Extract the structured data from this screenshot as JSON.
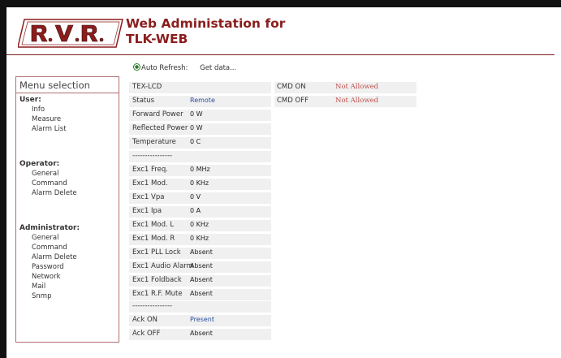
{
  "header": {
    "logo_text": "R.V.R.",
    "title_line1": "Web Administation for",
    "title_line2": "TLK-WEB"
  },
  "refresh": {
    "auto_refresh_label": "Auto Refresh:",
    "get_data_label": "Get data..."
  },
  "menu": {
    "title": "Menu selection",
    "user": {
      "label": "User:",
      "items": [
        "Info",
        "Measure",
        "Alarm List"
      ]
    },
    "operator": {
      "label": "Operator:",
      "items": [
        "General",
        "Command",
        "Alarm Delete"
      ]
    },
    "administrator": {
      "label": "Administrator:",
      "items": [
        "General",
        "Command",
        "Alarm Delete",
        "Password",
        "Network",
        "Mail",
        "Snmp"
      ]
    }
  },
  "table": {
    "rows": [
      {
        "label": "TEX-LCD",
        "value": ""
      },
      {
        "label": "Status",
        "value": "Remote"
      },
      {
        "label": "Forward Power",
        "value": "0  W"
      },
      {
        "label": "Reflected Power",
        "value": "0  W"
      },
      {
        "label": "Temperature",
        "value": "0  C"
      },
      {
        "label": "----------------",
        "value": ""
      },
      {
        "label": "Exc1 Freq.",
        "value": "0  MHz"
      },
      {
        "label": "Exc1 Mod.",
        "value": "0  KHz"
      },
      {
        "label": "Exc1 Vpa",
        "value": "0  V"
      },
      {
        "label": "Exc1 Ipa",
        "value": "0  A"
      },
      {
        "label": "Exc1 Mod. L",
        "value": "0  KHz"
      },
      {
        "label": "Exc1 Mod. R",
        "value": "0  KHz"
      },
      {
        "label": "Exc1 PLL Lock",
        "value": "Absent"
      },
      {
        "label": "Exc1 Audio Alarm",
        "value": "Absent"
      },
      {
        "label": "Exc1 Foldback",
        "value": "Absent"
      },
      {
        "label": "Exc1 R.F. Mute",
        "value": "Absent"
      },
      {
        "label": "",
        "value": ""
      },
      {
        "label": "----------------",
        "value": ""
      },
      {
        "label": "Ack ON",
        "value": "Present"
      },
      {
        "label": "Ack OFF",
        "value": "Absent"
      }
    ]
  },
  "commands": {
    "rows": [
      {
        "label": "CMD ON",
        "value": "Not Allowed"
      },
      {
        "label": "CMD OFF",
        "value": "Not Allowed"
      }
    ]
  },
  "colors": {
    "brand": "#8b1d1d",
    "link_blue": "#2b4fa0",
    "not_allowed": "#c0504d",
    "row_bg": "#f0f0f0"
  }
}
